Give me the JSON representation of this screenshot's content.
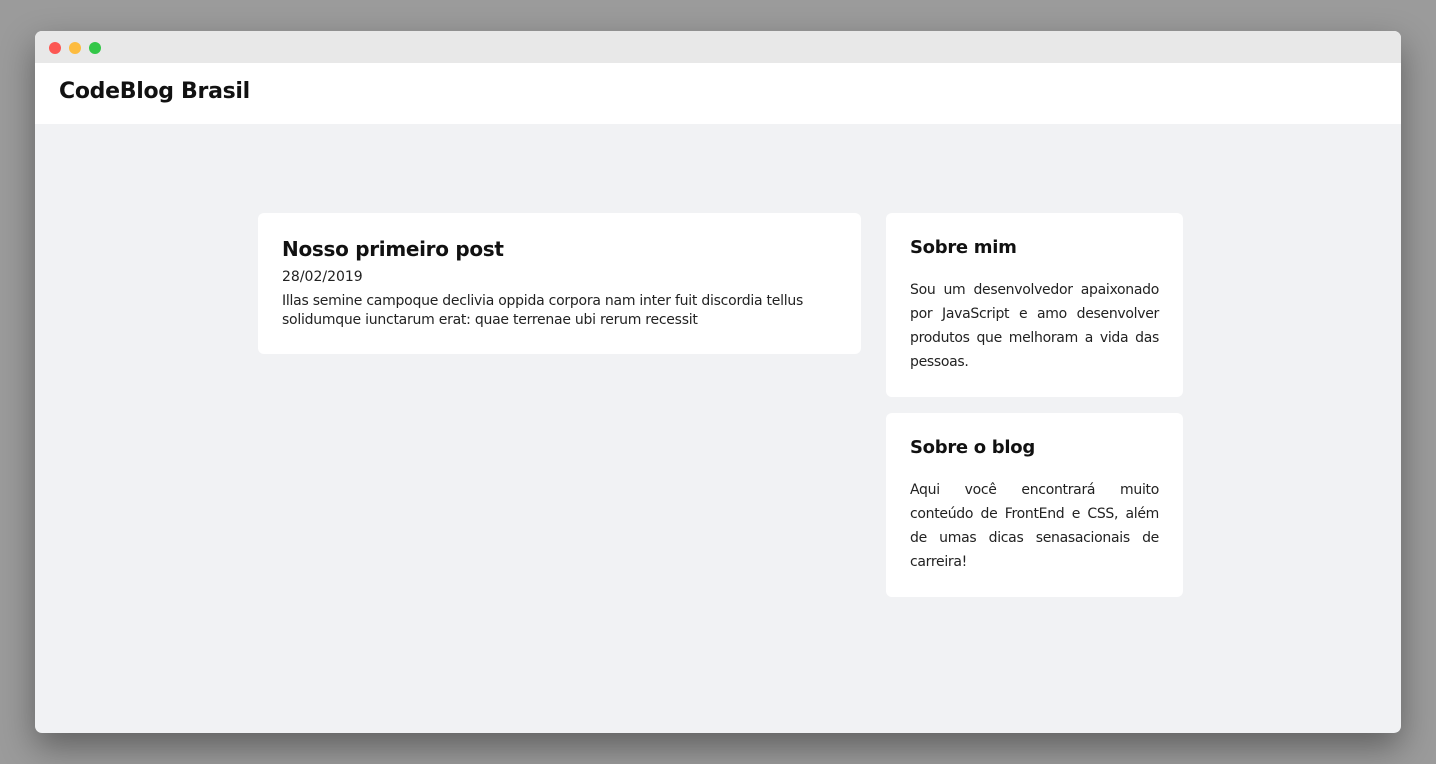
{
  "header": {
    "brand": "CodeBlog Brasil"
  },
  "post": {
    "title": "Nosso primeiro post",
    "date": "28/02/2019",
    "excerpt": "Illas semine campoque declivia oppida corpora nam inter fuit discordia tellus solidumque iunctarum erat: quae terrenae ubi rerum recessit"
  },
  "sidebar": {
    "about_me": {
      "title": "Sobre mim",
      "text": "Sou um desenvolvedor apaixonado por JavaScript e amo desenvolver produtos que melhoram a vida das pessoas."
    },
    "about_blog": {
      "title": "Sobre o blog",
      "text": "Aqui você encontrará muito conteúdo de FrontEnd e CSS, além de umas dicas senasacionais de carreira!"
    }
  },
  "colors": {
    "page_background": "#f1f2f4",
    "card_background": "#ffffff",
    "window_close": "#fc5753",
    "window_minimize": "#fdbc40",
    "window_maximize": "#33c748"
  }
}
